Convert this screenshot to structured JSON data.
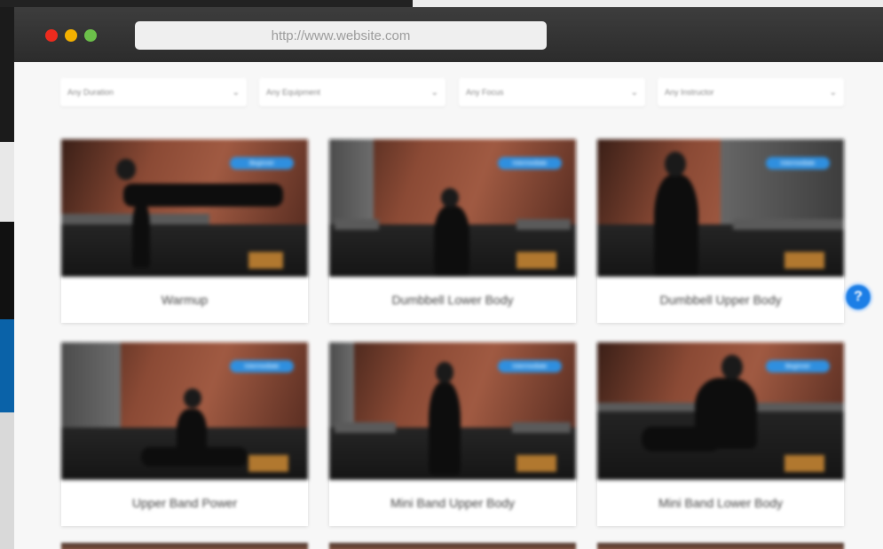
{
  "browser": {
    "url": "http://www.website.com"
  },
  "filters": [
    {
      "label": "Any Duration"
    },
    {
      "label": "Any Equipment"
    },
    {
      "label": "Any Focus"
    },
    {
      "label": "Any Instructor"
    }
  ],
  "cards": [
    {
      "title": "Warmup",
      "badge": "Beginner"
    },
    {
      "title": "Dumbbell Lower Body",
      "badge": "Intermediate"
    },
    {
      "title": "Dumbbell Upper Body",
      "badge": "Intermediate"
    },
    {
      "title": "Upper Band Power",
      "badge": "Intermediate"
    },
    {
      "title": "Mini Band Upper Body",
      "badge": "Intermediate"
    },
    {
      "title": "Mini Band Lower Body",
      "badge": "Beginner"
    }
  ],
  "help": {
    "label": "?"
  },
  "colors": {
    "titlebar": "#333333",
    "badge": "#2f8fdf",
    "help_button": "#1c7ee6",
    "page_background": "#f7f7f7"
  }
}
